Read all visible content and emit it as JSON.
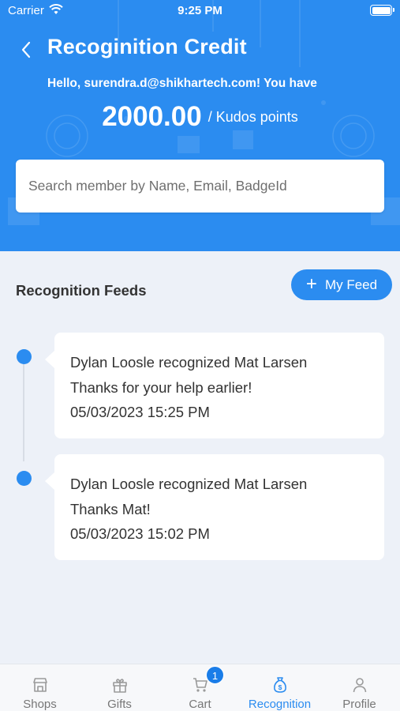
{
  "status_bar": {
    "carrier": "Carrier",
    "time": "9:25 PM"
  },
  "header": {
    "title": "Recoginition Credit",
    "greeting": "Hello, surendra.d@shikhartech.com! You have",
    "points_value": "2000.00",
    "points_unit": "/ Kudos points"
  },
  "search": {
    "placeholder": "Search member by Name, Email, BadgeId",
    "value": ""
  },
  "feeds": {
    "title": "Recognition Feeds",
    "my_feed_label": "My Feed",
    "items": [
      {
        "headline": "Dylan Loosle recognized Mat Larsen",
        "message": "Thanks for your help earlier!",
        "timestamp": "05/03/2023 15:25 PM"
      },
      {
        "headline": "Dylan Loosle recognized Mat Larsen",
        "message": "Thanks Mat!",
        "timestamp": "05/03/2023 15:02 PM"
      }
    ]
  },
  "tabbar": {
    "tabs": [
      {
        "label": "Shops",
        "icon": "shop-icon",
        "active": false
      },
      {
        "label": "Gifts",
        "icon": "gift-icon",
        "active": false
      },
      {
        "label": "Cart",
        "icon": "cart-icon",
        "active": false,
        "badge": "1"
      },
      {
        "label": "Recognition",
        "icon": "money-bag-icon",
        "active": true
      },
      {
        "label": "Profile",
        "icon": "person-icon",
        "active": false
      }
    ]
  },
  "colors": {
    "accent": "#2b8cf0",
    "background": "#edf1f8",
    "inactive_tab": "#777777"
  }
}
